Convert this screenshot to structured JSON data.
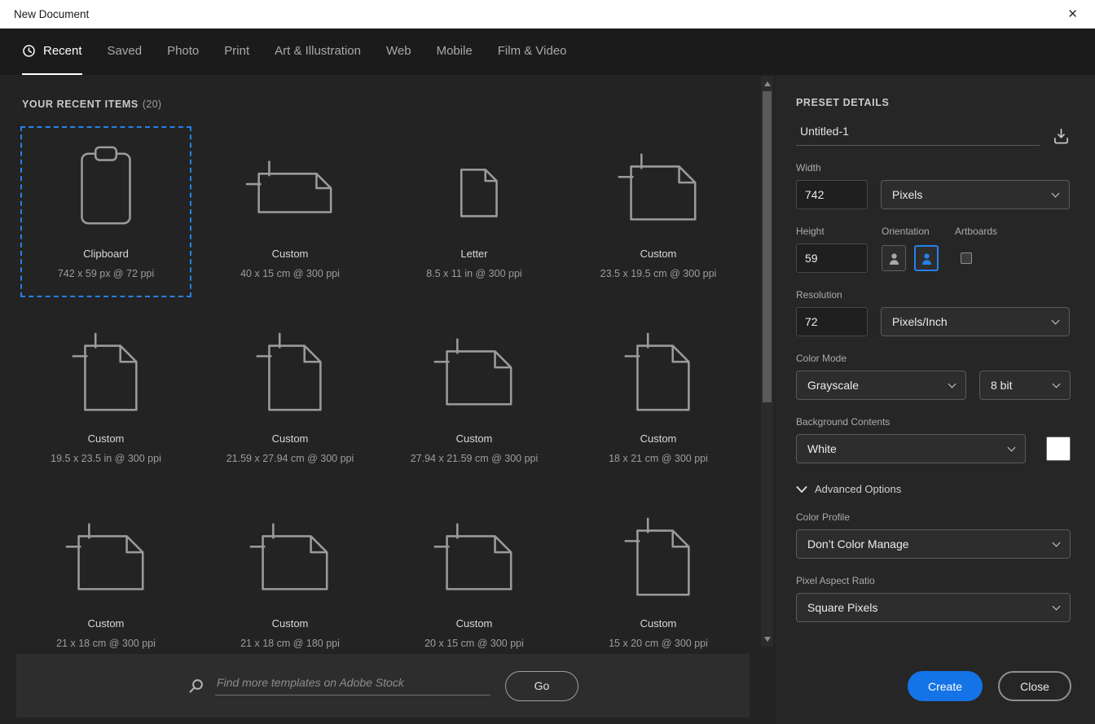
{
  "window": {
    "title": "New Document",
    "close_glyph": "✕"
  },
  "colors": {
    "accent": "#1473e6",
    "selection": "#2680eb"
  },
  "tabs": [
    {
      "label": "Recent",
      "active": true,
      "icon": "clock-icon"
    },
    {
      "label": "Saved"
    },
    {
      "label": "Photo"
    },
    {
      "label": "Print"
    },
    {
      "label": "Art & Illustration"
    },
    {
      "label": "Web"
    },
    {
      "label": "Mobile"
    },
    {
      "label": "Film & Video"
    }
  ],
  "recent": {
    "header": "YOUR RECENT ITEMS",
    "count": "(20)",
    "items": [
      {
        "name": "Clipboard",
        "spec": "742 x 59 px @ 72 ppi",
        "icon": "clipboard-icon",
        "selected": true
      },
      {
        "name": "Custom",
        "spec": "40 x 15 cm @ 300 ppi",
        "icon": "doc-wide-icon"
      },
      {
        "name": "Letter",
        "spec": "8.5 x 11 in @ 300 ppi",
        "icon": "doc-letter-icon"
      },
      {
        "name": "Custom",
        "spec": "23.5 x 19.5 cm @ 300 ppi",
        "icon": "doc-landscape-icon"
      },
      {
        "name": "Custom",
        "spec": "19.5 x 23.5 in @ 300 ppi",
        "icon": "doc-portrait-icon"
      },
      {
        "name": "Custom",
        "spec": "21.59 x 27.94 cm @ 300 ppi",
        "icon": "doc-portrait-icon"
      },
      {
        "name": "Custom",
        "spec": "27.94 x 21.59 cm @ 300 ppi",
        "icon": "doc-landscape-icon"
      },
      {
        "name": "Custom",
        "spec": "18 x 21 cm @ 300 ppi",
        "icon": "doc-portrait-icon"
      },
      {
        "name": "Custom",
        "spec": "21 x 18 cm @ 300 ppi",
        "icon": "doc-landscape-icon"
      },
      {
        "name": "Custom",
        "spec": "21 x 18 cm @ 180 ppi",
        "icon": "doc-landscape-icon"
      },
      {
        "name": "Custom",
        "spec": "20 x 15 cm @ 300 ppi",
        "icon": "doc-landscape-icon"
      },
      {
        "name": "Custom",
        "spec": "15 x 20 cm @ 300 ppi",
        "icon": "doc-portrait-icon"
      }
    ]
  },
  "search": {
    "placeholder": "Find more templates on Adobe Stock",
    "go": "Go"
  },
  "panel": {
    "header": "PRESET DETAILS",
    "doc_name": "Untitled-1",
    "width": {
      "label": "Width",
      "value": "742",
      "unit": "Pixels"
    },
    "height": {
      "label": "Height",
      "value": "59"
    },
    "orientation_label": "Orientation",
    "artboards_label": "Artboards",
    "resolution": {
      "label": "Resolution",
      "value": "72",
      "unit": "Pixels/Inch"
    },
    "color_mode": {
      "label": "Color Mode",
      "value": "Grayscale",
      "depth": "8 bit"
    },
    "background": {
      "label": "Background Contents",
      "value": "White",
      "swatch": "#ffffff"
    },
    "advanced_label": "Advanced Options",
    "color_profile": {
      "label": "Color Profile",
      "value": "Don’t Color Manage"
    },
    "pixel_aspect": {
      "label": "Pixel Aspect Ratio",
      "value": "Square Pixels"
    },
    "create": "Create",
    "close": "Close"
  }
}
